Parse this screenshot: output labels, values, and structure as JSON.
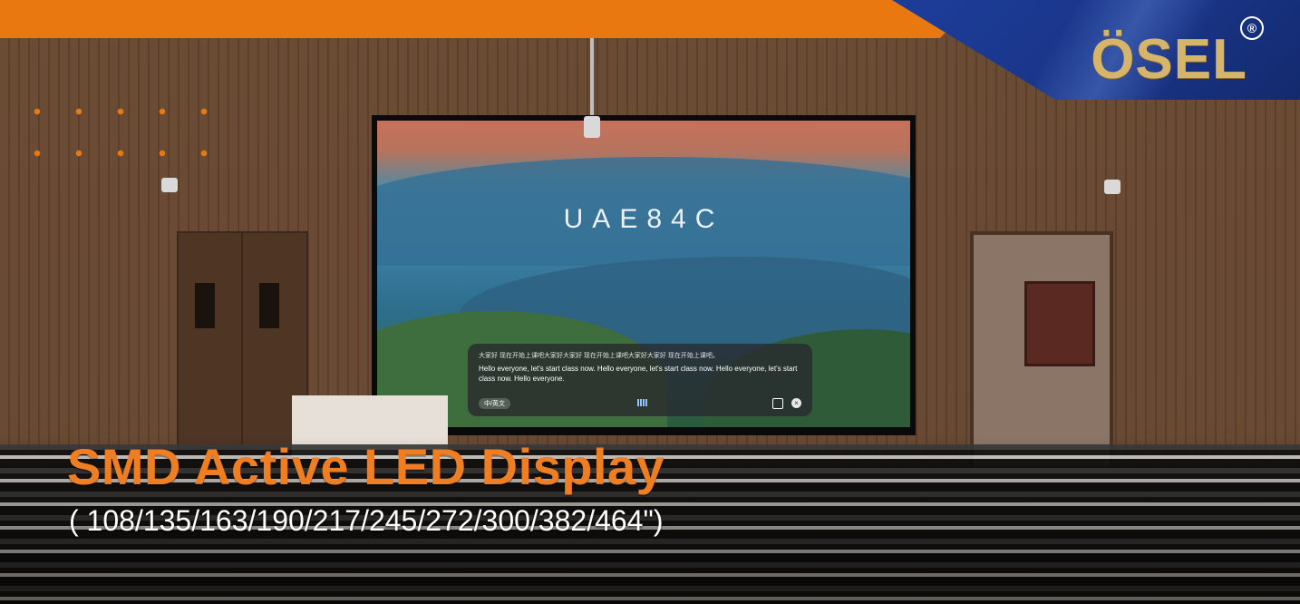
{
  "brand": {
    "logo_text": "ÖSEL",
    "registered_mark": "®"
  },
  "screen": {
    "title": "UAE84C",
    "subtitle": "",
    "caption_panel": {
      "chinese_line": "大家好 现在开始上课吧大家好大家好 现在开始上课吧大家好大家好 现在开始上课吧。",
      "english_text": "Hello everyone, let's start class now. Hello everyone, let's start class now. Hello everyone, let's start class now. Hello everyone.",
      "language_pill": "中/英文"
    }
  },
  "headline": {
    "title": "SMD Active LED Display",
    "sizes": "( 108/135/163/190/217/245/272/300/382/464\")"
  },
  "icons": [
    "audio-wave-icon",
    "expand-icon",
    "close-icon"
  ],
  "colors": {
    "accent_orange": "#e8780f",
    "brand_blue": "#1c3d9a",
    "logo_gold": "#d6b56a"
  }
}
